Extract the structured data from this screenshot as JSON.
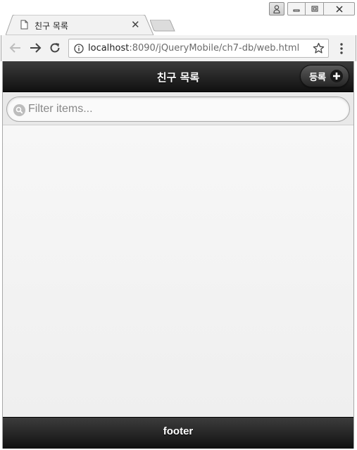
{
  "browser": {
    "tab": {
      "title": "친구 목록",
      "favicon": "page-icon",
      "close_icon": "close-icon"
    },
    "address_bar": {
      "host": "localhost",
      "path": ":8090/jQueryMobile/ch7-db/web.html"
    },
    "icons": {
      "back": "arrow-left-icon",
      "forward": "arrow-right-icon",
      "reload": "reload-icon",
      "info": "info-icon",
      "bookmark": "star-icon",
      "menu": "kebab-menu-icon"
    },
    "window_controls": {
      "user": "user-icon",
      "minimize": "minimize-icon",
      "maximize": "maximize-icon",
      "close": "close-icon"
    }
  },
  "page": {
    "header": {
      "title": "친구 목록",
      "add_button_label": "등록",
      "add_icon": "plus-icon"
    },
    "filter": {
      "placeholder": "Filter items...",
      "value": ""
    },
    "list": {
      "items": []
    },
    "footer": {
      "title": "footer"
    }
  },
  "colors": {
    "header_bg": "#1f1f1f",
    "page_bg": "#f2f2f2",
    "filter_bar_bg": "#e9e9e9"
  }
}
